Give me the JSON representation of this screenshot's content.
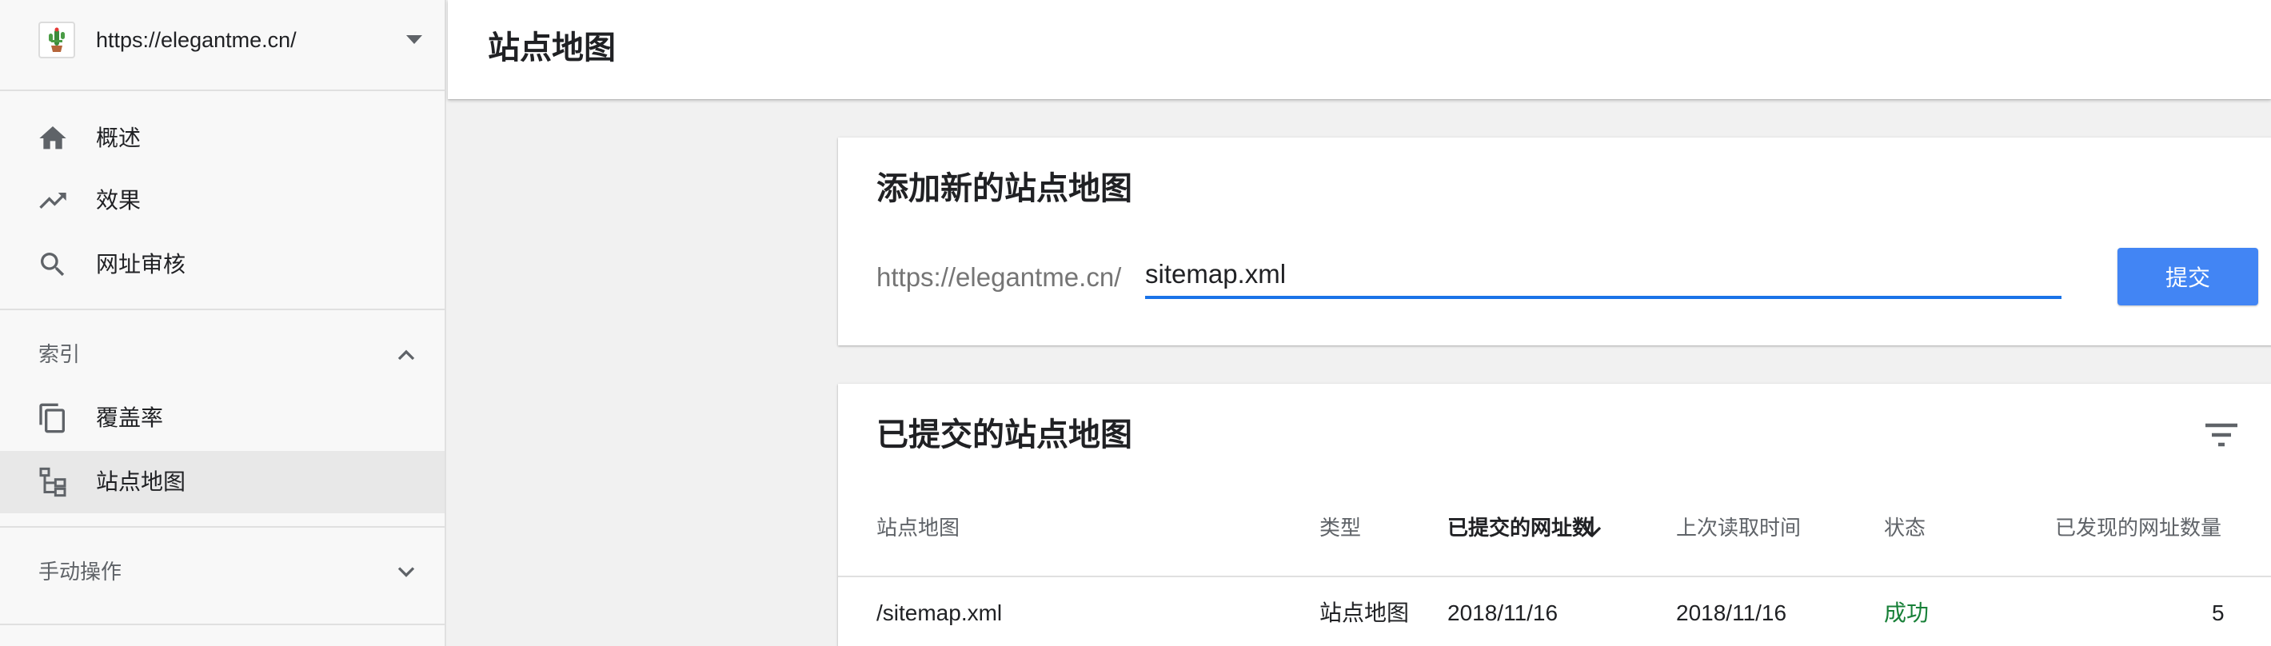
{
  "property": {
    "url": "https://elegantme.cn/",
    "favicon": "cactus-favicon"
  },
  "sidebar": {
    "items": [
      {
        "label": "概述",
        "icon": "home-icon"
      },
      {
        "label": "效果",
        "icon": "trending-up-icon"
      },
      {
        "label": "网址审核",
        "icon": "search-icon"
      }
    ],
    "index_section": {
      "label": "索引",
      "items": [
        {
          "label": "覆盖率",
          "icon": "copy-icon"
        },
        {
          "label": "站点地图",
          "icon": "sitemap-icon",
          "active": true
        }
      ]
    },
    "manual_section": {
      "label": "手动操作"
    }
  },
  "header": {
    "title": "站点地图"
  },
  "add_card": {
    "title": "添加新的站点地图",
    "prefix": "https://elegantme.cn/",
    "input_value": "sitemap.xml",
    "submit_label": "提交"
  },
  "submitted_card": {
    "title": "已提交的站点地图",
    "columns": [
      "站点地图",
      "类型",
      "已提交的网址数",
      "上次读取时间",
      "状态",
      "已发现的网址数量"
    ],
    "rows": [
      {
        "sitemap": "/sitemap.xml",
        "type": "站点地图",
        "submitted": "2018/11/16",
        "last_read": "2018/11/16",
        "status": "成功",
        "discovered": "5"
      }
    ]
  },
  "colors": {
    "accent": "#4285f4",
    "input_underline": "#1a73e8",
    "success": "#188038"
  }
}
